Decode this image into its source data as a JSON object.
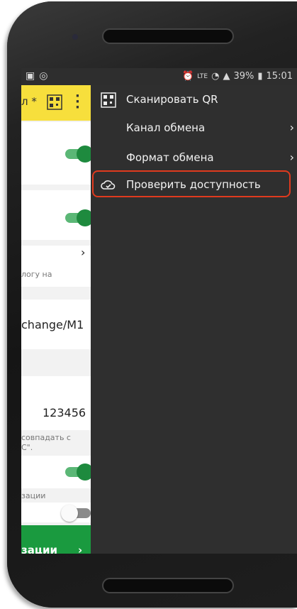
{
  "status": {
    "battery": "39%",
    "time": "15:01",
    "net": "LTE"
  },
  "app": {
    "title_fragment": "л *"
  },
  "rows": {
    "partial_text_1": "логу на",
    "field_value_path": "change/M1",
    "field_value_number": "123456",
    "note_line1": "совпадать с",
    "note_line2": "С\".",
    "section_label": "зации",
    "bottom_button_label": "зации",
    "chevron": "›"
  },
  "menu": {
    "items": [
      {
        "label": "Сканировать QR",
        "icon": "qr-icon",
        "submenu": false
      },
      {
        "label": "Канал обмена",
        "icon": "",
        "submenu": true
      },
      {
        "label": "Формат обмена",
        "icon": "",
        "submenu": true
      },
      {
        "label": "Проверить доступность",
        "icon": "cloud-check-icon",
        "submenu": false
      }
    ],
    "chevron": "›"
  },
  "colors": {
    "accent_yellow": "#f7df3c",
    "green": "#1a9a3f",
    "highlight": "#e03a1e"
  }
}
